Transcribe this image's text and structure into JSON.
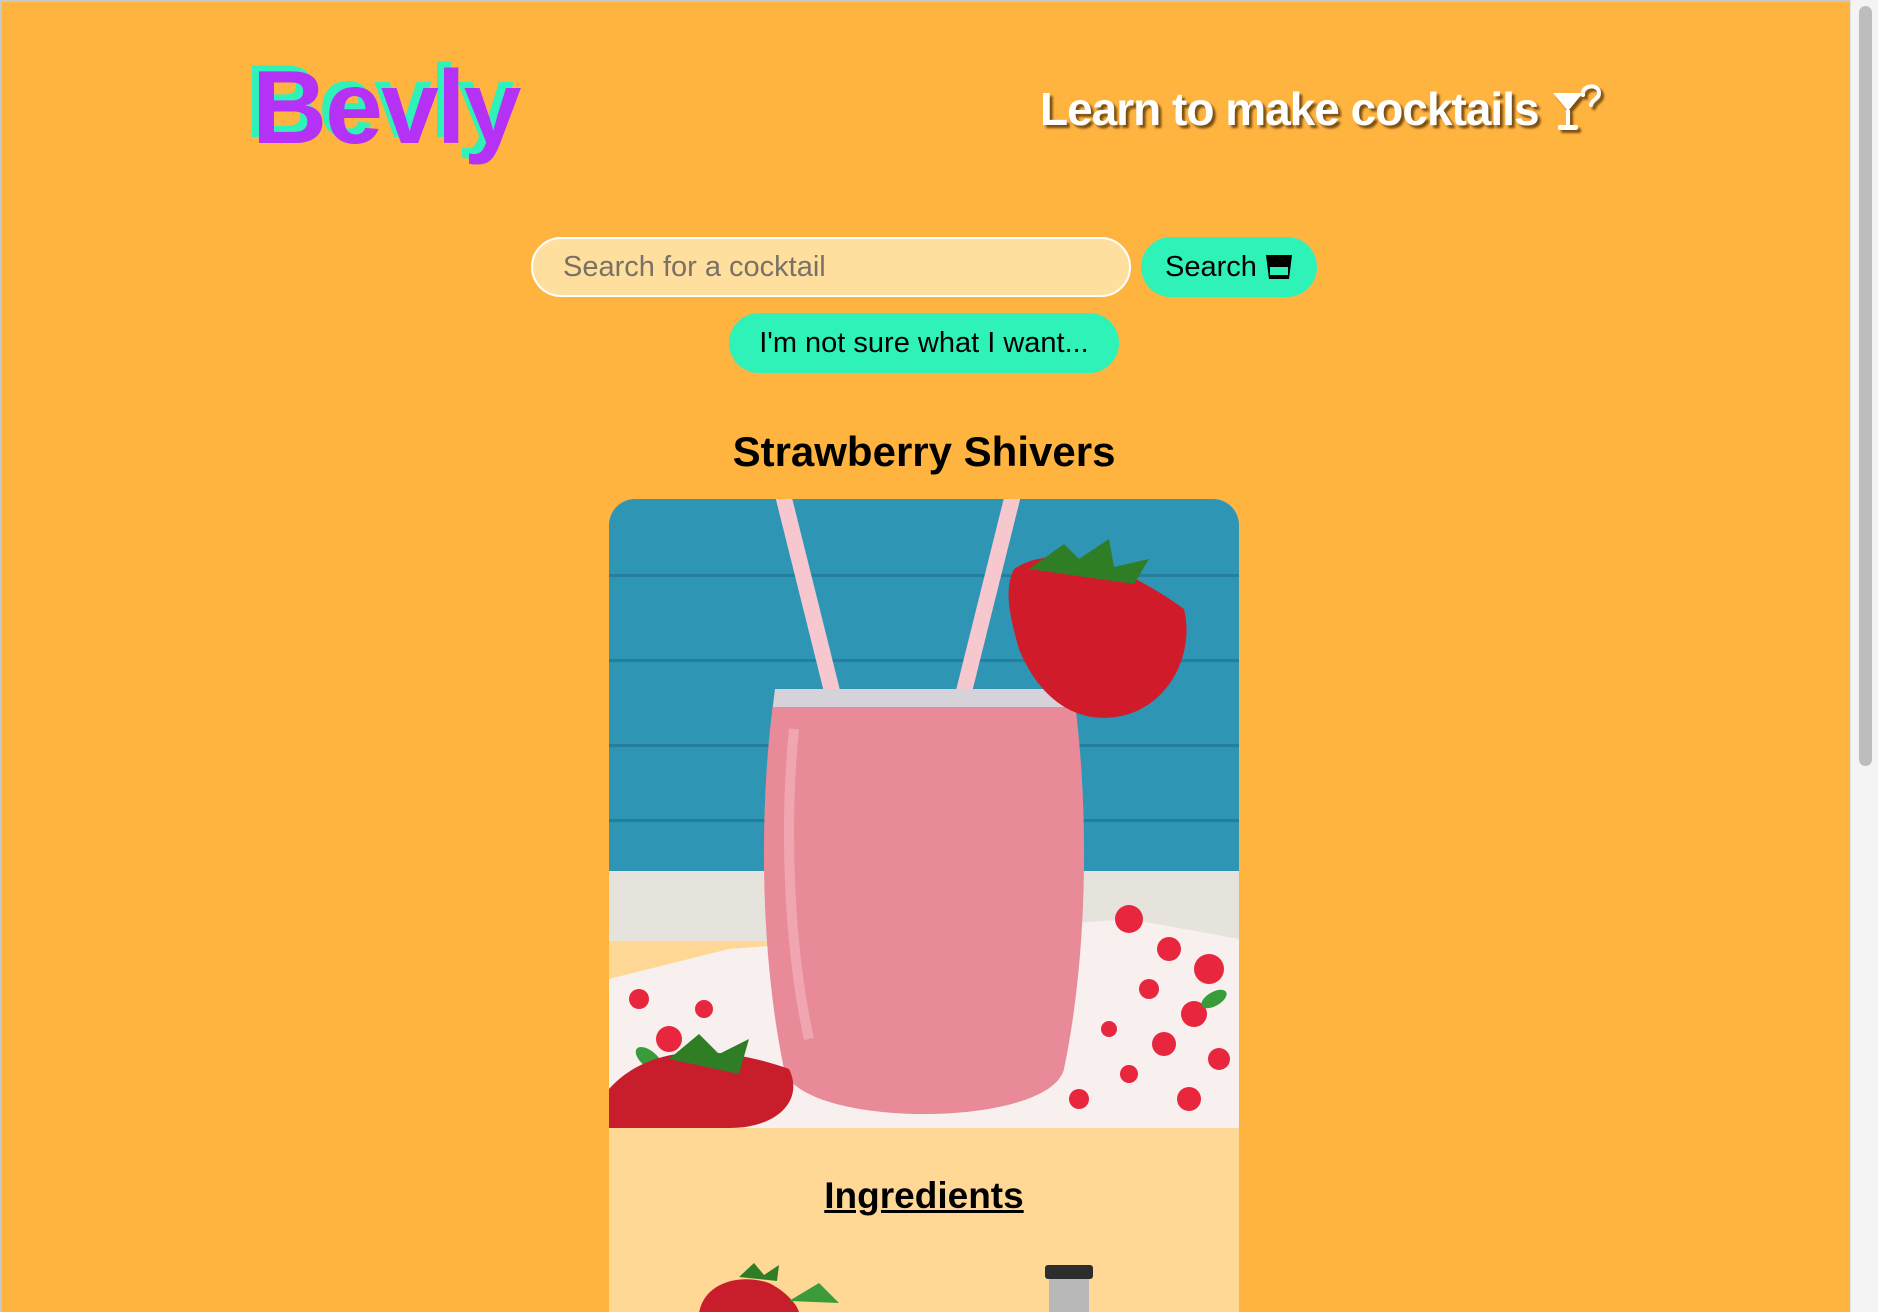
{
  "header": {
    "logo_text": "Bevly",
    "nav_link_label": "Learn to make cocktails",
    "nav_link_icon": "cocktail-question-icon"
  },
  "search": {
    "placeholder": "Search for a cocktail",
    "value": "",
    "button_label": "Search",
    "button_icon": "glass-icon",
    "random_button_label": "I'm not sure what I want..."
  },
  "drink": {
    "name": "Strawberry Shivers",
    "image_icon": "strawberry-smoothie-photo",
    "ingredients_heading": "Ingredients",
    "ingredient_icons": [
      "strawberry-icon",
      "jar-icon"
    ]
  },
  "colors": {
    "background": "#ffb43f",
    "accent": "#2ff2b9",
    "logo": "#b531f5",
    "card": "#ffd895"
  }
}
